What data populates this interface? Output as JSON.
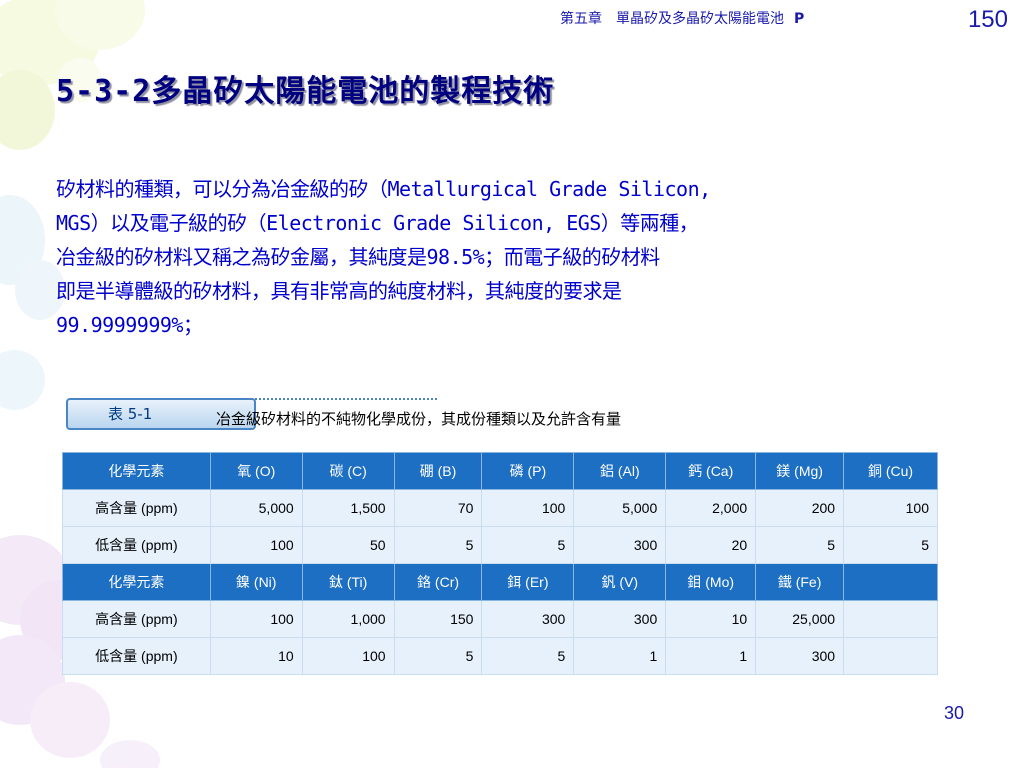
{
  "header": {
    "chapter": "第五章　單晶矽及多晶矽太陽能電池",
    "chapter_tag": "P",
    "page_number": "150"
  },
  "title": "5-3-2多晶矽太陽能電池的製程技術",
  "paragraph_lines": [
    "矽材料的種類，可以分為冶金級的矽（Metallurgical Grade Silicon,",
    "MGS）以及電子級的矽（Electronic Grade Silicon, EGS）等兩種，",
    "冶金級的矽材料又稱之為矽金屬，其純度是98.5%；而電子級的矽材料",
    "即是半導體級的矽材料，具有非常高的純度材料，其純度的要求是",
    "99.9999999%；"
  ],
  "table": {
    "tab_label": "表 5-1",
    "caption": "冶金級矽材料的不純物化學成份，其成份種類以及允許含有量",
    "header_1": [
      "化學元素",
      "氧 (O)",
      "碳 (C)",
      "硼 (B)",
      "磷 (P)",
      "鋁 (Al)",
      "鈣 (Ca)",
      "鎂 (Mg)",
      "銅 (Cu)"
    ],
    "high_1": [
      "高含量 (ppm)",
      "5,000",
      "1,500",
      "70",
      "100",
      "5,000",
      "2,000",
      "200",
      "100"
    ],
    "low_1": [
      "低含量 (ppm)",
      "100",
      "50",
      "5",
      "5",
      "300",
      "20",
      "5",
      "5"
    ],
    "header_2": [
      "化學元素",
      "鎳 (Ni)",
      "鈦 (Ti)",
      "鉻 (Cr)",
      "鉺 (Er)",
      "釩 (V)",
      "鉬 (Mo)",
      "鐵 (Fe)",
      ""
    ],
    "high_2": [
      "高含量 (ppm)",
      "100",
      "1,000",
      "150",
      "300",
      "300",
      "10",
      "25,000",
      ""
    ],
    "low_2": [
      "低含量 (ppm)",
      "10",
      "100",
      "5",
      "5",
      "1",
      "1",
      "300",
      ""
    ]
  },
  "footer": {
    "slide_number": "30"
  },
  "colors": {
    "title": "#000080",
    "body_text": "#0000cc",
    "table_header_bg": "#1d6fc3",
    "table_row_bg": "#e6f1fb"
  }
}
